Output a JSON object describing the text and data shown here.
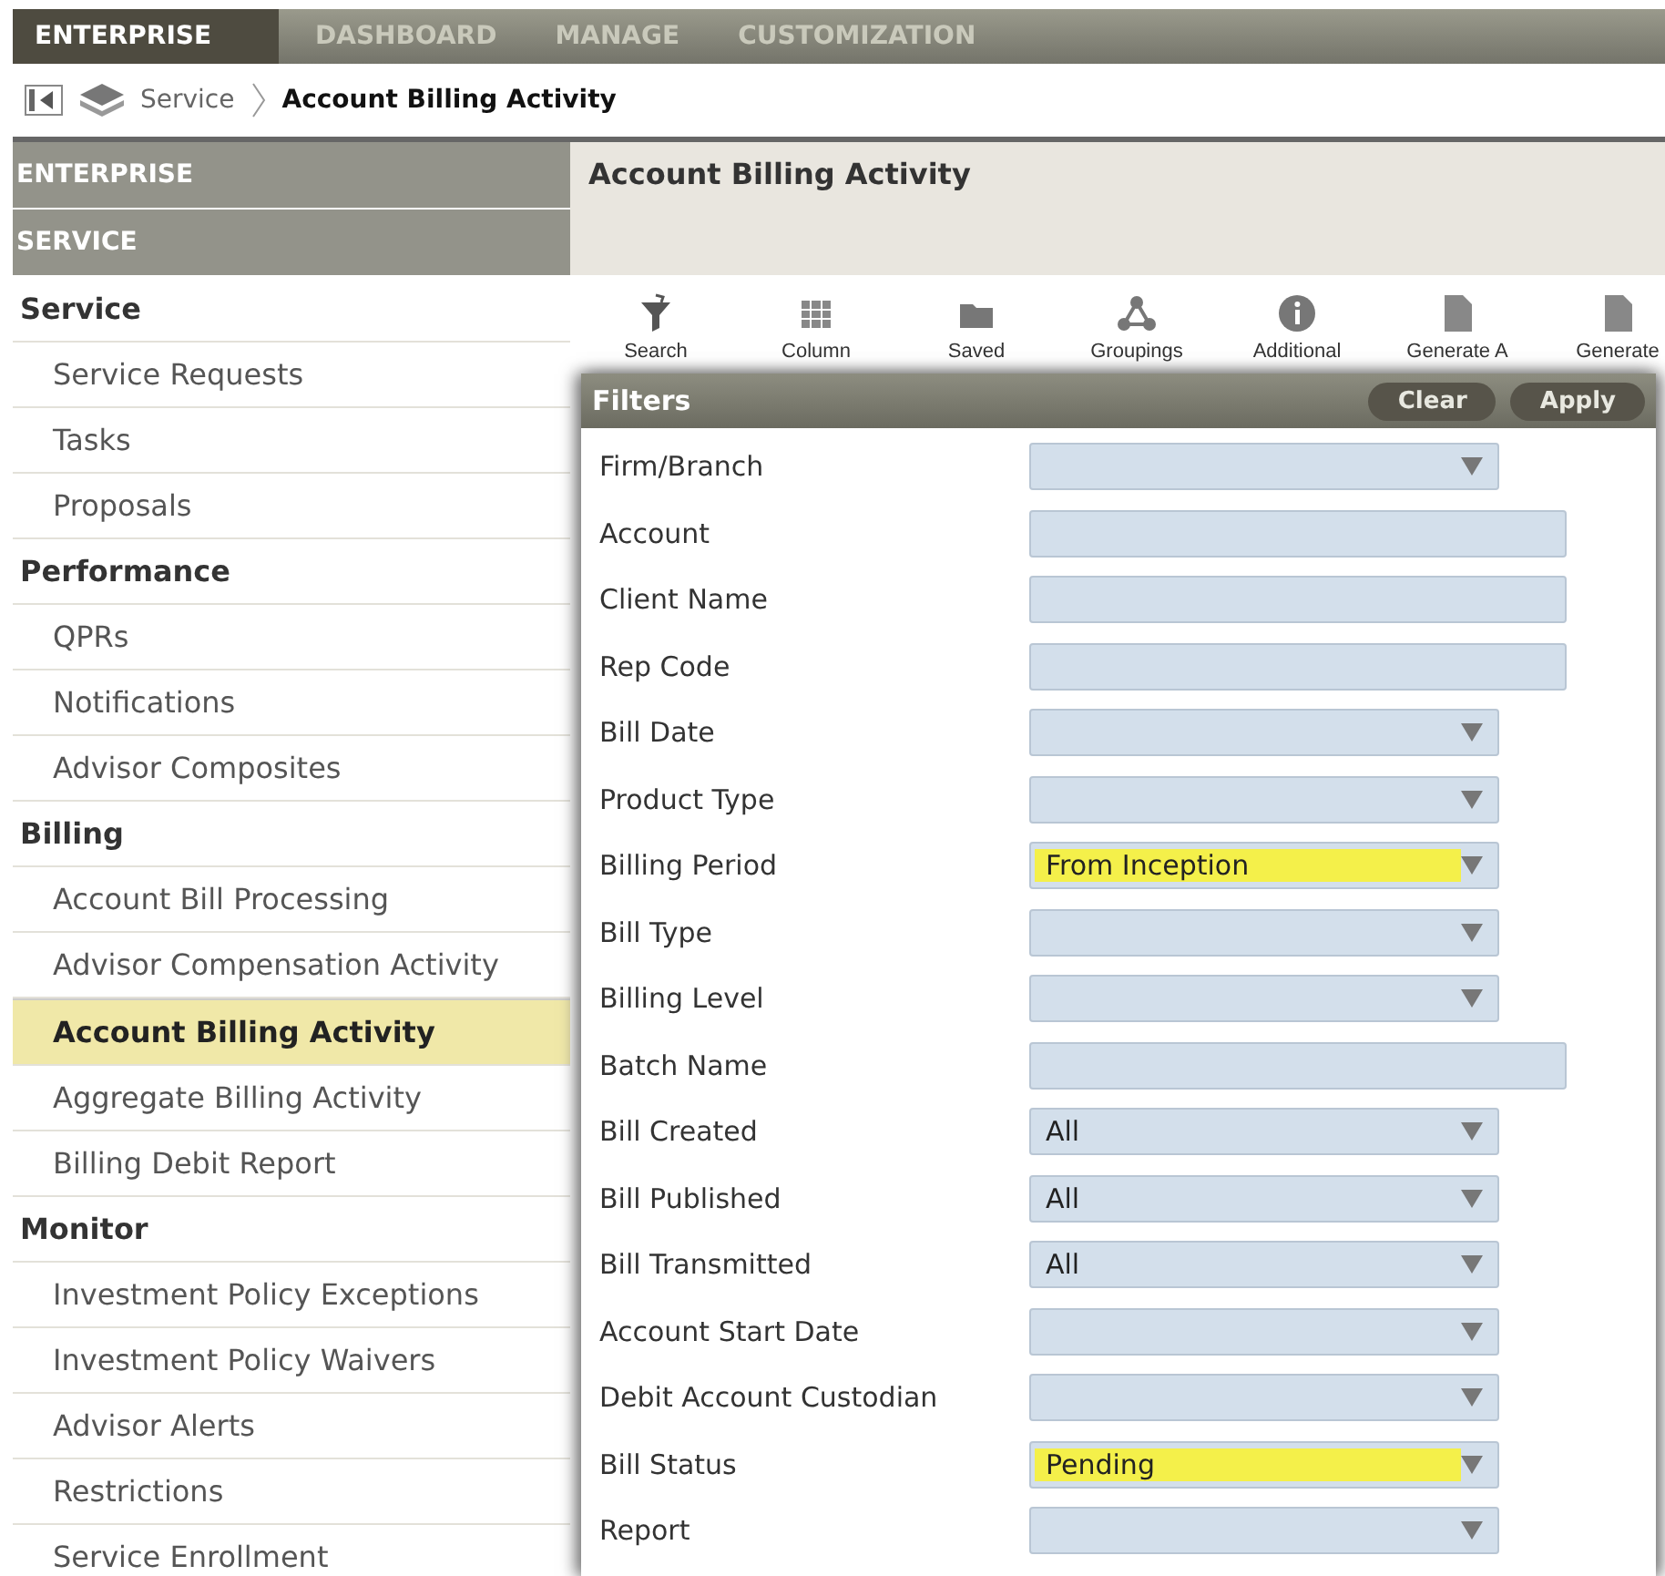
{
  "top_nav": [
    {
      "label": "ENTERPRISE",
      "selected": true
    },
    {
      "label": "DASHBOARD",
      "selected": false
    },
    {
      "label": "MANAGE",
      "selected": false
    },
    {
      "label": "CUSTOMIZATION",
      "selected": false
    }
  ],
  "breadcrumb": {
    "parent": "Service",
    "current": "Account Billing Activity"
  },
  "sidebar": {
    "sections": [
      "ENTERPRISE",
      "SERVICE"
    ],
    "groups": [
      {
        "title": "Service",
        "items": [
          {
            "label": "Service Requests",
            "selected": false
          },
          {
            "label": "Tasks",
            "selected": false
          },
          {
            "label": "Proposals",
            "selected": false
          }
        ]
      },
      {
        "title": "Performance",
        "items": [
          {
            "label": "QPRs",
            "selected": false
          },
          {
            "label": "Notifications",
            "selected": false
          },
          {
            "label": "Advisor Composites",
            "selected": false
          }
        ]
      },
      {
        "title": "Billing",
        "items": [
          {
            "label": "Account Bill Processing",
            "selected": false
          },
          {
            "label": "Advisor Compensation Activity",
            "selected": false
          },
          {
            "label": "Account Billing Activity",
            "selected": true
          },
          {
            "label": "Aggregate Billing Activity",
            "selected": false
          },
          {
            "label": "Billing Debit Report",
            "selected": false
          }
        ]
      },
      {
        "title": "Monitor",
        "items": [
          {
            "label": "Investment Policy Exceptions",
            "selected": false
          },
          {
            "label": "Investment Policy Waivers",
            "selected": false
          },
          {
            "label": "Advisor Alerts",
            "selected": false
          },
          {
            "label": "Restrictions",
            "selected": false
          },
          {
            "label": "Service Enrollment",
            "selected": false
          }
        ]
      }
    ]
  },
  "page_title": "Account Billing Activity",
  "toolbar": [
    {
      "label": "Search"
    },
    {
      "label": "Column"
    },
    {
      "label": "Saved"
    },
    {
      "label": "Groupings"
    },
    {
      "label": "Additional"
    },
    {
      "label": "Generate A"
    },
    {
      "label": "Generate"
    }
  ],
  "filters": {
    "title": "Filters",
    "buttons": [
      "Clear",
      "Apply"
    ],
    "fields": [
      {
        "label": "Firm/Branch",
        "kind": "select"
      },
      {
        "label": "Account",
        "kind": "text"
      },
      {
        "label": "Client Name",
        "kind": "text"
      },
      {
        "label": "Rep Code",
        "kind": "text"
      },
      {
        "label": "Bill Date",
        "kind": "select"
      },
      {
        "label": "Product Type",
        "kind": "select"
      },
      {
        "label": "Billing Period",
        "kind": "select",
        "value": "From Inception",
        "highlighted": true
      },
      {
        "label": "Bill Type",
        "kind": "select"
      },
      {
        "label": "Billing Level",
        "kind": "select"
      },
      {
        "label": "Batch Name",
        "kind": "text"
      },
      {
        "label": "Bill Created",
        "kind": "select",
        "value": "All",
        "highlighted": false
      },
      {
        "label": "Bill Published",
        "kind": "select",
        "value": "All",
        "highlighted": false
      },
      {
        "label": "Bill Transmitted",
        "kind": "select",
        "value": "All",
        "highlighted": false
      },
      {
        "label": "Account Start Date",
        "kind": "select"
      },
      {
        "label": "Debit Account Custodian",
        "kind": "select"
      },
      {
        "label": "Bill Status",
        "kind": "select",
        "value": "Pending",
        "highlighted": true
      },
      {
        "label": "Report",
        "kind": "select"
      }
    ]
  }
}
